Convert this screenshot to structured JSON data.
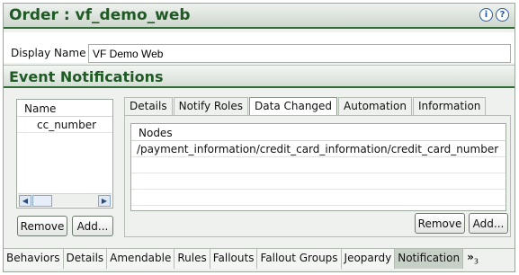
{
  "window": {
    "title": "Order : vf_demo_web"
  },
  "display_name": {
    "label": "Display Name",
    "value": "VF Demo Web"
  },
  "section": {
    "title": "Event Notifications"
  },
  "left_list": {
    "header": "Name",
    "items": [
      "cc_number"
    ],
    "buttons": {
      "remove": "Remove",
      "add": "Add..."
    }
  },
  "tabs": [
    "Details",
    "Notify Roles",
    "Data Changed",
    "Automation",
    "Information"
  ],
  "active_tab": "Data Changed",
  "nodes_table": {
    "header": "Nodes",
    "rows": [
      "/payment_information/credit_card_information/credit_card_number"
    ]
  },
  "panel_buttons": {
    "remove": "Remove",
    "add": "Add..."
  },
  "bottom_tabs": [
    "Behaviors",
    "Details",
    "Amendable",
    "Rules",
    "Fallouts",
    "Fallout Groups",
    "Jeopardy",
    "Notification"
  ],
  "active_bottom_tab": "Notification",
  "more_tabs": {
    "symbol": "»",
    "count": "3"
  },
  "icons": {
    "info": "info-icon",
    "help": "help-icon"
  },
  "colors": {
    "accent": "#2f6b35",
    "title": "#1f5a25",
    "icon": "#2a5a9e"
  }
}
